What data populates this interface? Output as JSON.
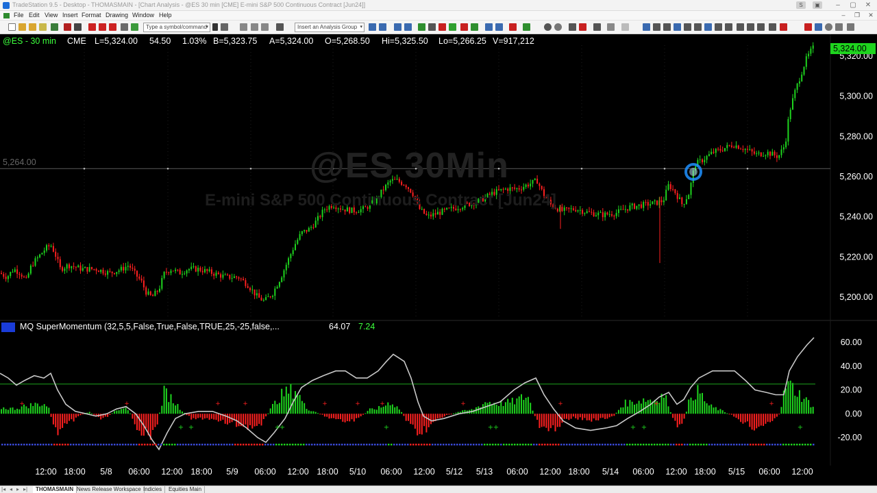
{
  "window": {
    "title": "TradeStation 9.5 - Desktop - THOMASMAIN - [Chart Analysis - @ES 30 min [CME] E-mini S&P 500 Continuous Contract [Jun24]]"
  },
  "menu": {
    "items": [
      "File",
      "Edit",
      "View",
      "Insert",
      "Format",
      "Drawing",
      "Window",
      "Help"
    ]
  },
  "toolbar": {
    "symbol_placeholder": "Type a symbol/command",
    "analysis_group_placeholder": "Insert an Analysis Group"
  },
  "chart_header": {
    "symbol": "@ES - 30 min",
    "exchange": "CME",
    "last": "L=5,324.00",
    "net_change": "54.50",
    "pct_change": "1.03%",
    "bid": "B=5,323.75",
    "ask": "A=5,324.00",
    "open": "O=5,268.50",
    "high": "Hi=5,325.50",
    "low": "Lo=5,266.25",
    "volume": "V=917,212"
  },
  "watermark": {
    "line1": "@ES 30Min",
    "line2": "E-mini S&P 500 Continuous Contract [Jun24]"
  },
  "horizontal_line_label": "5,264.00",
  "last_price_tag": "5,324.00",
  "indicator": {
    "name": "MQ SuperMomentum (32,5,5,False,True,False,TRUE,25,-25,false,...",
    "value1": "64.07",
    "value2": "7.24"
  },
  "colors": {
    "up_bar": "#1ed41e",
    "down_bar": "#ff2020",
    "momentum_line": "#c8c8c8",
    "threshold_line": "#1ea51e",
    "cursor_ring": "#1e90ff"
  },
  "chart_data": [
    {
      "type": "candlestick",
      "title": "@ES 30Min",
      "ylim": [
        5190,
        5330
      ],
      "yticks": [
        "5,320.00",
        "5,300.00",
        "5,280.00",
        "5,260.00",
        "5,240.00",
        "5,220.00",
        "5,200.00"
      ],
      "ytick_values": [
        5320,
        5300,
        5280,
        5260,
        5240,
        5220,
        5200
      ],
      "horizontal_line": 5264,
      "last": 5324,
      "x_tick_labels": [
        "12:00",
        "18:00",
        "5/8",
        "06:00",
        "12:00",
        "18:00",
        "5/9",
        "06:00",
        "12:00",
        "18:00",
        "5/10",
        "06:00",
        "12:00",
        "5/12",
        "5/13",
        "06:00",
        "12:00",
        "18:00",
        "5/14",
        "06:00",
        "12:00",
        "18:00",
        "5/15",
        "06:00",
        "12:00"
      ],
      "close_path": [
        [
          0,
          5212
        ],
        [
          10,
          5210
        ],
        [
          20,
          5214
        ],
        [
          30,
          5212
        ],
        [
          38,
          5208
        ],
        [
          46,
          5216
        ],
        [
          56,
          5220
        ],
        [
          66,
          5224
        ],
        [
          74,
          5226
        ],
        [
          80,
          5222
        ],
        [
          88,
          5214
        ],
        [
          100,
          5216
        ],
        [
          120,
          5214
        ],
        [
          140,
          5214
        ],
        [
          160,
          5212
        ],
        [
          178,
          5214
        ],
        [
          188,
          5216
        ],
        [
          196,
          5212
        ],
        [
          206,
          5208
        ],
        [
          214,
          5202
        ],
        [
          222,
          5200
        ],
        [
          232,
          5204
        ],
        [
          240,
          5212
        ],
        [
          250,
          5214
        ],
        [
          262,
          5212
        ],
        [
          274,
          5214
        ],
        [
          290,
          5214
        ],
        [
          310,
          5212
        ],
        [
          330,
          5210
        ],
        [
          348,
          5210
        ],
        [
          362,
          5206
        ],
        [
          376,
          5200
        ],
        [
          386,
          5198
        ],
        [
          398,
          5202
        ],
        [
          410,
          5210
        ],
        [
          420,
          5218
        ],
        [
          430,
          5226
        ],
        [
          440,
          5232
        ],
        [
          452,
          5234
        ],
        [
          462,
          5238
        ],
        [
          474,
          5244
        ],
        [
          486,
          5246
        ],
        [
          500,
          5244
        ],
        [
          516,
          5243
        ],
        [
          532,
          5244
        ],
        [
          548,
          5248
        ],
        [
          560,
          5254
        ],
        [
          570,
          5258
        ],
        [
          580,
          5258
        ],
        [
          592,
          5256
        ],
        [
          602,
          5252
        ],
        [
          612,
          5244
        ],
        [
          624,
          5240
        ],
        [
          640,
          5242
        ],
        [
          660,
          5244
        ],
        [
          680,
          5246
        ],
        [
          700,
          5248
        ],
        [
          720,
          5252
        ],
        [
          740,
          5254
        ],
        [
          756,
          5254
        ],
        [
          770,
          5256
        ],
        [
          784,
          5258
        ],
        [
          792,
          5252
        ],
        [
          804,
          5246
        ],
        [
          820,
          5243
        ],
        [
          840,
          5244
        ],
        [
          860,
          5242
        ],
        [
          880,
          5241
        ],
        [
          900,
          5242
        ],
        [
          920,
          5245
        ],
        [
          940,
          5246
        ],
        [
          958,
          5247
        ],
        [
          968,
          5248
        ],
        [
          976,
          5256
        ],
        [
          986,
          5252
        ],
        [
          996,
          5246
        ],
        [
          1006,
          5252
        ],
        [
          1014,
          5266
        ],
        [
          1024,
          5268
        ],
        [
          1040,
          5272
        ],
        [
          1056,
          5274
        ],
        [
          1070,
          5276
        ],
        [
          1086,
          5274
        ],
        [
          1104,
          5271
        ],
        [
          1120,
          5272
        ],
        [
          1136,
          5270
        ],
        [
          1146,
          5276
        ],
        [
          1152,
          5292
        ],
        [
          1160,
          5302
        ],
        [
          1168,
          5310
        ],
        [
          1176,
          5318
        ],
        [
          1186,
          5324
        ]
      ]
    },
    {
      "type": "line",
      "title": "MQ SuperMomentum (32,5,5,False,True,False,TRUE,25,-25,false,...",
      "ylim": [
        -30,
        70
      ],
      "yticks": [
        "60.00",
        "40.00",
        "20.00",
        "0.00",
        "-20.00"
      ],
      "ytick_values": [
        60,
        40,
        20,
        0,
        -20
      ],
      "threshold_upper": 25,
      "threshold_lower": -25,
      "series": [
        {
          "values_path": [
            [
              0,
              34
            ],
            [
              12,
              30
            ],
            [
              24,
              24
            ],
            [
              36,
              28
            ],
            [
              50,
              32
            ],
            [
              64,
              30
            ],
            [
              74,
              34
            ],
            [
              84,
              20
            ],
            [
              96,
              8
            ],
            [
              110,
              2
            ],
            [
              126,
              0
            ],
            [
              140,
              -2
            ],
            [
              156,
              0
            ],
            [
              170,
              4
            ],
            [
              184,
              6
            ],
            [
              198,
              0
            ],
            [
              210,
              -10
            ],
            [
              222,
              -22
            ],
            [
              232,
              -30
            ],
            [
              244,
              -16
            ],
            [
              256,
              -4
            ],
            [
              270,
              0
            ],
            [
              290,
              2
            ],
            [
              310,
              2
            ],
            [
              330,
              -2
            ],
            [
              346,
              -6
            ],
            [
              360,
              -12
            ],
            [
              376,
              -20
            ],
            [
              388,
              -24
            ],
            [
              400,
              -16
            ],
            [
              416,
              -4
            ],
            [
              428,
              10
            ],
            [
              440,
              22
            ],
            [
              456,
              28
            ],
            [
              472,
              32
            ],
            [
              490,
              36
            ],
            [
              504,
              36
            ],
            [
              520,
              30
            ],
            [
              536,
              30
            ],
            [
              552,
              36
            ],
            [
              564,
              44
            ],
            [
              574,
              50
            ],
            [
              590,
              44
            ],
            [
              600,
              30
            ],
            [
              610,
              10
            ],
            [
              618,
              -2
            ],
            [
              630,
              -6
            ],
            [
              648,
              -4
            ],
            [
              670,
              0
            ],
            [
              690,
              2
            ],
            [
              710,
              6
            ],
            [
              730,
              10
            ],
            [
              750,
              20
            ],
            [
              766,
              26
            ],
            [
              782,
              30
            ],
            [
              794,
              16
            ],
            [
              808,
              4
            ],
            [
              822,
              -6
            ],
            [
              840,
              -12
            ],
            [
              862,
              -14
            ],
            [
              884,
              -12
            ],
            [
              900,
              -10
            ],
            [
              916,
              -4
            ],
            [
              934,
              2
            ],
            [
              950,
              8
            ],
            [
              962,
              14
            ],
            [
              976,
              18
            ],
            [
              988,
              8
            ],
            [
              998,
              12
            ],
            [
              1008,
              22
            ],
            [
              1020,
              30
            ],
            [
              1040,
              36
            ],
            [
              1056,
              36
            ],
            [
              1072,
              36
            ],
            [
              1088,
              28
            ],
            [
              1102,
              20
            ],
            [
              1118,
              18
            ],
            [
              1132,
              16
            ],
            [
              1144,
              16
            ],
            [
              1152,
              36
            ],
            [
              1164,
              48
            ],
            [
              1178,
              58
            ],
            [
              1188,
              64
            ]
          ]
        }
      ],
      "histogram_profile": [
        [
          0,
          6
        ],
        [
          20,
          5
        ],
        [
          40,
          8
        ],
        [
          60,
          10
        ],
        [
          70,
          8
        ],
        [
          80,
          -18
        ],
        [
          96,
          -14
        ],
        [
          110,
          -4
        ],
        [
          130,
          2
        ],
        [
          150,
          -6
        ],
        [
          170,
          4
        ],
        [
          184,
          8
        ],
        [
          200,
          -12
        ],
        [
          214,
          -22
        ],
        [
          226,
          -20
        ],
        [
          240,
          22
        ],
        [
          252,
          14
        ],
        [
          262,
          6
        ],
        [
          280,
          -6
        ],
        [
          300,
          -4
        ],
        [
          320,
          -8
        ],
        [
          340,
          -10
        ],
        [
          360,
          -12
        ],
        [
          380,
          -14
        ],
        [
          396,
          6
        ],
        [
          410,
          18
        ],
        [
          422,
          22
        ],
        [
          432,
          24
        ],
        [
          446,
          6
        ],
        [
          460,
          2
        ],
        [
          480,
          -4
        ],
        [
          500,
          -8
        ],
        [
          520,
          -6
        ],
        [
          540,
          4
        ],
        [
          556,
          6
        ],
        [
          570,
          12
        ],
        [
          584,
          4
        ],
        [
          600,
          -14
        ],
        [
          614,
          -18
        ],
        [
          630,
          -10
        ],
        [
          650,
          -2
        ],
        [
          670,
          2
        ],
        [
          690,
          4
        ],
        [
          710,
          12
        ],
        [
          730,
          10
        ],
        [
          750,
          12
        ],
        [
          770,
          18
        ],
        [
          786,
          -12
        ],
        [
          800,
          -20
        ],
        [
          816,
          -10
        ],
        [
          836,
          -4
        ],
        [
          856,
          -6
        ],
        [
          876,
          -6
        ],
        [
          896,
          -2
        ],
        [
          910,
          10
        ],
        [
          926,
          12
        ],
        [
          940,
          14
        ],
        [
          956,
          14
        ],
        [
          970,
          20
        ],
        [
          984,
          -10
        ],
        [
          996,
          -14
        ],
        [
          1008,
          18
        ],
        [
          1020,
          22
        ],
        [
          1034,
          8
        ],
        [
          1050,
          4
        ],
        [
          1070,
          -2
        ],
        [
          1090,
          -10
        ],
        [
          1104,
          -14
        ],
        [
          1120,
          -8
        ],
        [
          1136,
          -4
        ],
        [
          1148,
          30
        ],
        [
          1160,
          24
        ],
        [
          1172,
          16
        ],
        [
          1186,
          8
        ]
      ]
    }
  ],
  "bottom_tabs": [
    "THOMASMAIN",
    "News Release Workspace",
    "Indicies",
    "Equities Main"
  ]
}
